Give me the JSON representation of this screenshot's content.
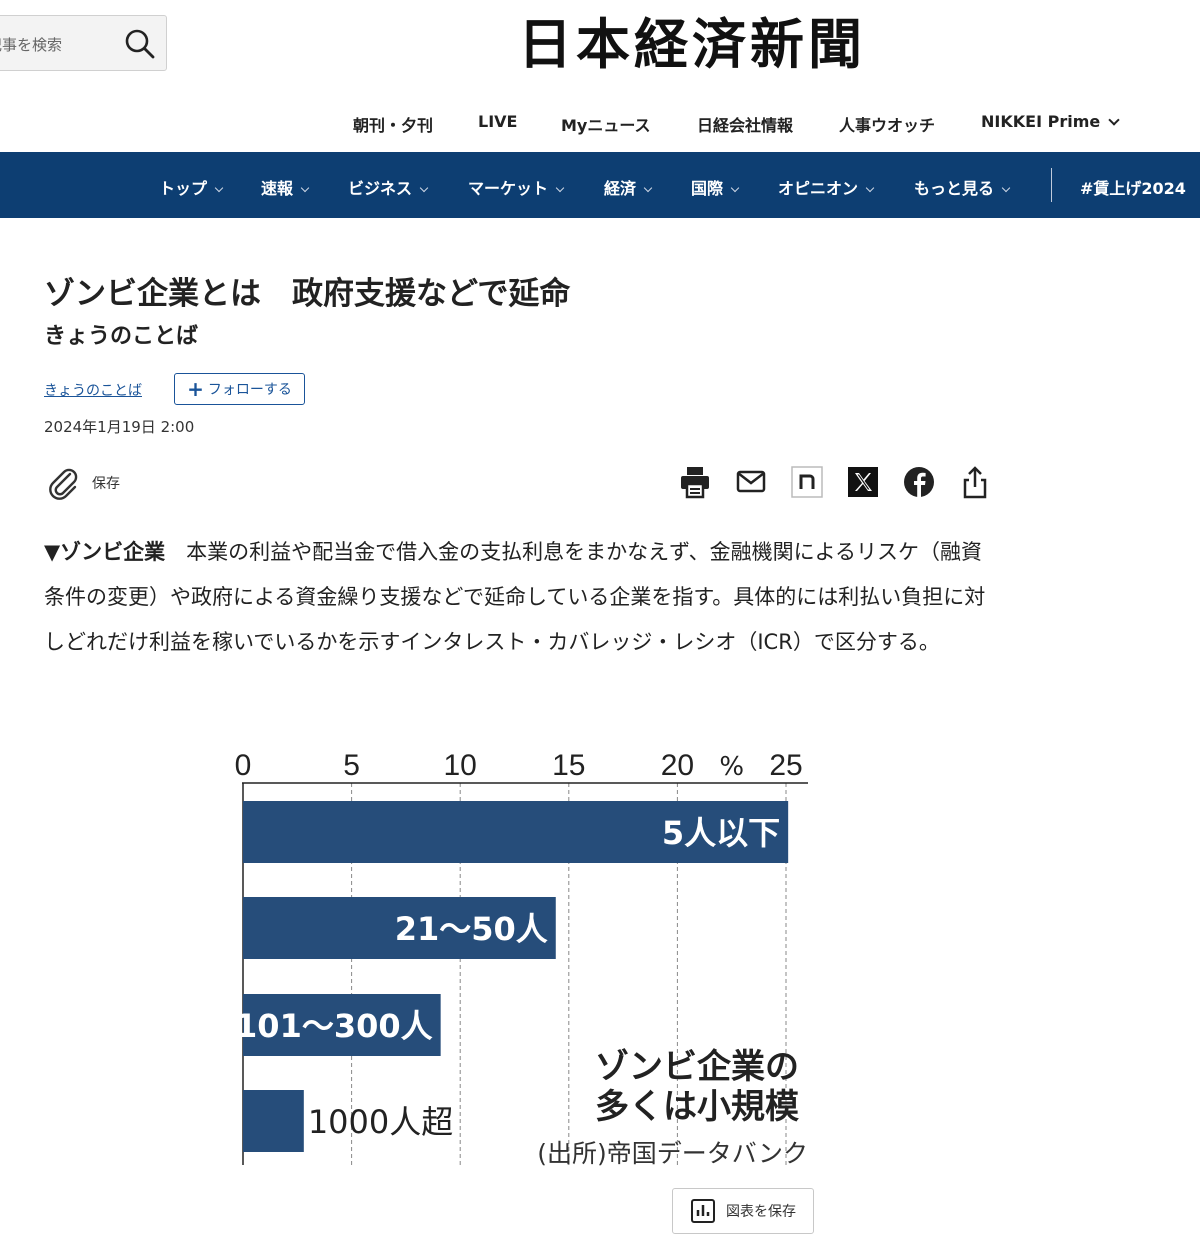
{
  "header": {
    "search_placeholder": "記事を検索",
    "masthead": "日本経済新聞",
    "subnav": [
      "朝刊・夕刊",
      "LIVE",
      "Myニュース",
      "日経会社情報",
      "人事ウオッチ",
      "NIKKEI Prime"
    ],
    "mainnav": [
      "トップ",
      "速報",
      "ビジネス",
      "マーケット",
      "経済",
      "国際",
      "オピニオン",
      "もっと見る"
    ],
    "mainnav_special": "#賃上げ2024",
    "brand_color": "#0d3e72"
  },
  "article": {
    "title": "ゾンビ企業とは　政府支援などで延命",
    "subtitle": "きょうのことば",
    "topic_link": "きょうのことば",
    "follow_label": "フォローする",
    "date": "2024年1月19日 2:00",
    "save_label": "保存",
    "share_icons": [
      "print-icon",
      "mail-icon",
      "note-icon",
      "x-icon",
      "facebook-icon",
      "share-icon"
    ],
    "body_lead": "▼ゾンビ企業",
    "body": "　本業の利益や配当金で借入金の支払利息をまかなえず、金融機関によるリスケ（融資条件の変更）や政府による資金繰り支援などで延命している企業を指す。具体的には利払い負担に対しどれだけ利益を稼いでいるかを示すインタレスト・カバレッジ・レシオ（ICR）で区分する。"
  },
  "chart_data": {
    "type": "bar",
    "orientation": "horizontal",
    "categories": [
      "5人以下",
      "21～50人",
      "101～300人",
      "1000人超"
    ],
    "values": [
      25.1,
      14.4,
      9.1,
      2.8
    ],
    "x_ticks": [
      0,
      5,
      10,
      15,
      20,
      25
    ],
    "unit": "%",
    "xlim": [
      0,
      25
    ],
    "grid": true,
    "caption": [
      "ゾンビ企業の",
      "多くは小規模"
    ],
    "source": "(出所)帝国データバンク",
    "bar_color": "#264d7a",
    "save_label": "図表を保存"
  }
}
